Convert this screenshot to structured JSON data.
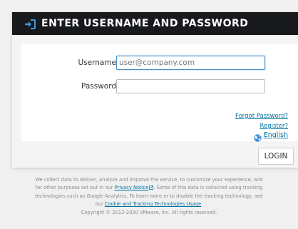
{
  "dialog": {
    "title": "ENTER USERNAME AND PASSWORD",
    "title_icon": "login-arrow-icon"
  },
  "form": {
    "username_label": "Username",
    "username_placeholder": "user@company.com",
    "password_label": "Password",
    "password_placeholder": ""
  },
  "links": {
    "forgot_password": "Forgot Password?",
    "register": "Register?",
    "language": "English",
    "language_icon": "globe-icon"
  },
  "actions": {
    "login_label": "LOGIN"
  },
  "notice": {
    "line1": "We collect data to deliver, analyze and improve the service, to customize your experience, and",
    "line2_pre": "for other purposes set out in our ",
    "privacy_link": "Privacy Notice",
    "line2_post": ". Some of this data is collected using tracking",
    "line3": "technologies such as Google Analytics. To learn more or to disable the tracking technology, see",
    "line4_pre": "our ",
    "cookie_link": "Cookie and Tracking Technologies Usage",
    "line4_post": ".",
    "copyright": "Copyright © 2012-2020 VMware, Inc. All rights reserved."
  },
  "colors": {
    "header_bg": "#17191c",
    "accent": "#3a9bd8",
    "link": "#0072a3"
  }
}
